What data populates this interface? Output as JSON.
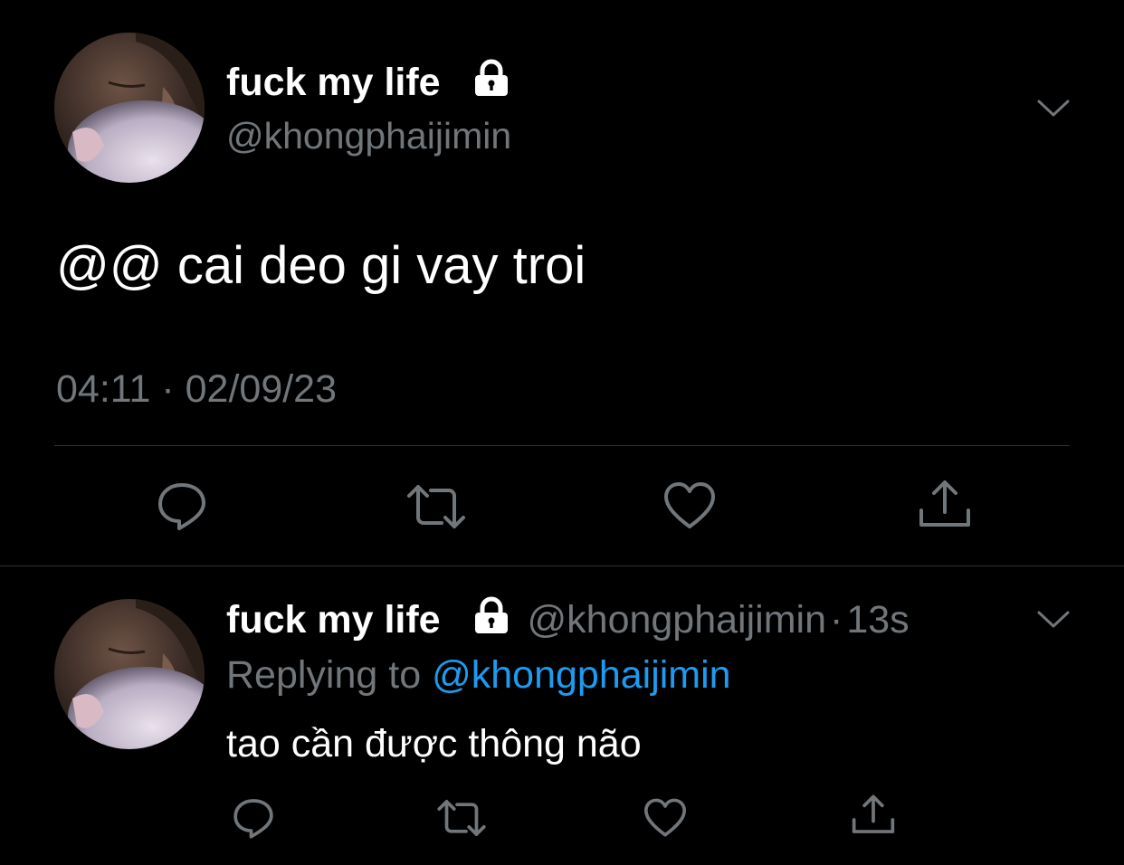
{
  "main_tweet": {
    "display_name": "fuck my life",
    "handle": "@khongphaijimin",
    "text": "@@ cai deo gi vay troi",
    "timestamp": "04:11 · 02/09/23"
  },
  "reply_tweet": {
    "display_name": "fuck my life",
    "handle": "@khongphaijimin",
    "separator": "·",
    "age": "13s",
    "replying_prefix": "Replying to",
    "replying_handle": "@khongphaijimin",
    "text": "tao cần được thông não"
  },
  "icons": {
    "protected": "lock-icon",
    "more": "chevron-down-icon",
    "reply": "reply-icon",
    "retweet": "retweet-icon",
    "like": "heart-icon",
    "share": "share-icon"
  },
  "colors": {
    "background": "#000000",
    "text": "#ffffff",
    "secondary": "#71767b",
    "link": "#1d9bf0",
    "divider": "#2f3336"
  }
}
